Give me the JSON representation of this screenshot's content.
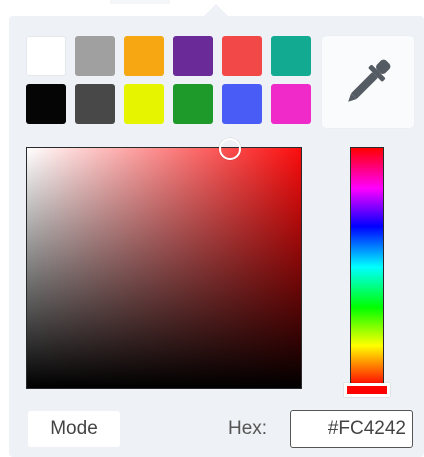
{
  "swatches": [
    {
      "color": "#ffffff"
    },
    {
      "color": "#a0a0a0"
    },
    {
      "color": "#f6a712"
    },
    {
      "color": "#6a2a98"
    },
    {
      "color": "#f34848"
    },
    {
      "color": "#12aa90"
    },
    {
      "color": "#050505"
    },
    {
      "color": "#484848"
    },
    {
      "color": "#e6f400"
    },
    {
      "color": "#1e9a2a"
    },
    {
      "color": "#4a5cf6"
    },
    {
      "color": "#f02ac8"
    }
  ],
  "eyedropper": {
    "icon": "eyedropper-icon"
  },
  "picker": {
    "hue_color": "#fc0d0d",
    "saturation": 0.74,
    "value": 0.99
  },
  "hue": {
    "value": 0,
    "handle_color": "#ff0000"
  },
  "mode": {
    "label": "Mode"
  },
  "hex": {
    "label": "Hex:",
    "value": "#FC4242"
  }
}
